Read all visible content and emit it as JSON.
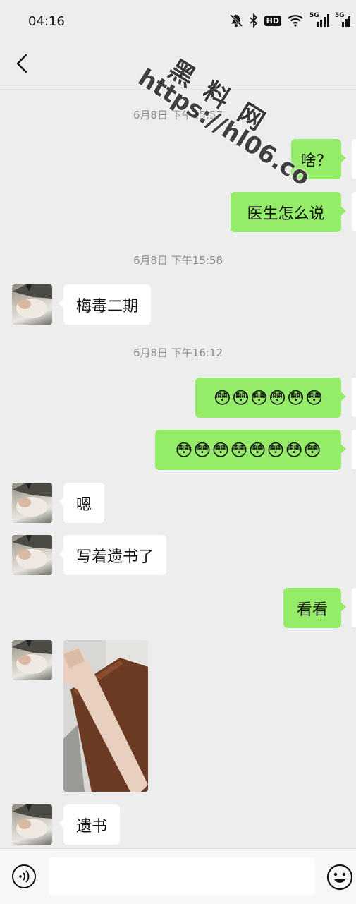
{
  "status_bar": {
    "time": "04:16",
    "network_badges": [
      "HD",
      "5G",
      "5G"
    ]
  },
  "nav": {
    "back_label": "<"
  },
  "timestamps": [
    "6月8日 下午15:57",
    "6月8日 下午15:58",
    "6月8日 下午16:12"
  ],
  "messages": [
    {
      "side": "right",
      "text": "啥？"
    },
    {
      "side": "right",
      "text": "医生怎么说"
    },
    {
      "side": "left",
      "text": "梅毒二期"
    },
    {
      "side": "right",
      "emoji": "😳",
      "emoji_count": 6
    },
    {
      "side": "right",
      "emoji": "😳",
      "emoji_count": 8
    },
    {
      "side": "left",
      "text": "嗯"
    },
    {
      "side": "left",
      "text": "写着遗书了"
    },
    {
      "side": "right",
      "text": "看看"
    },
    {
      "side": "left",
      "image": "photo-of-arm"
    },
    {
      "side": "left",
      "text": "遗书"
    }
  ],
  "watermark": {
    "title": "黑料网",
    "url": "https://hl06.co"
  },
  "icons": {
    "back": "back-arrow-icon",
    "voice": "voice-icon",
    "emoji": "emoji-icon",
    "mute": "bell-off-icon",
    "bluetooth": "bluetooth-icon",
    "wifi": "wifi-icon",
    "signal": "signal-icon"
  },
  "colors": {
    "sent_bubble": "#95ec69",
    "received_bubble": "#ffffff",
    "background": "#ededed"
  }
}
